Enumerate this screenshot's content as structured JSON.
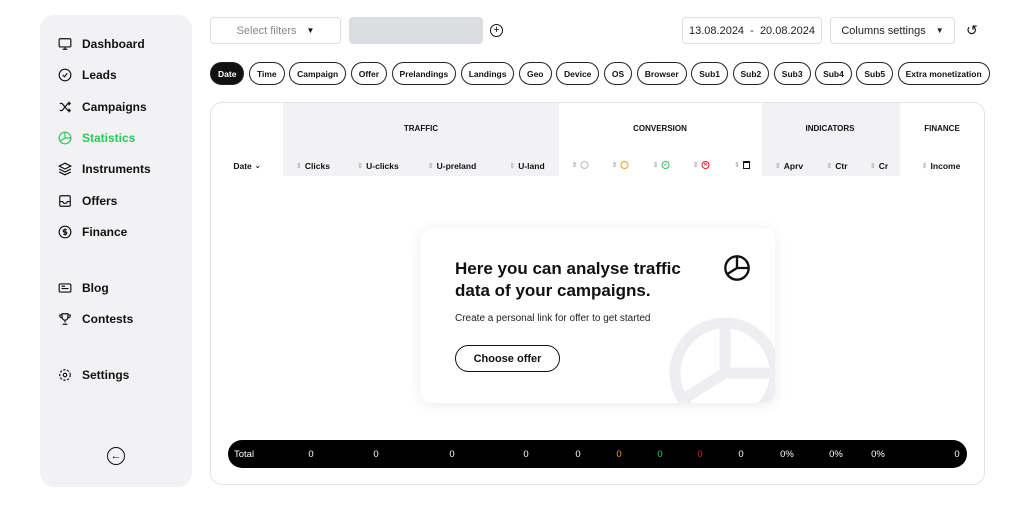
{
  "sidebar": {
    "items": [
      {
        "label": "Dashboard",
        "icon": "monitor-icon"
      },
      {
        "label": "Leads",
        "icon": "check-circle-icon"
      },
      {
        "label": "Campaigns",
        "icon": "shuffle-icon"
      },
      {
        "label": "Statistics",
        "icon": "pie-chart-icon",
        "active": true
      },
      {
        "label": "Instruments",
        "icon": "layers-icon"
      },
      {
        "label": "Offers",
        "icon": "inbox-icon"
      },
      {
        "label": "Finance",
        "icon": "dollar-icon"
      },
      {
        "label": "Blog",
        "icon": "newspaper-icon"
      },
      {
        "label": "Contests",
        "icon": "trophy-icon"
      },
      {
        "label": "Settings",
        "icon": "gear-icon"
      }
    ]
  },
  "toolbar": {
    "filters_placeholder": "Select filters",
    "date_range": "13.08.2024  -  20.08.2024",
    "columns_settings": "Columns settings"
  },
  "chips": [
    "Date",
    "Time",
    "Campaign",
    "Offer",
    "Prelandings",
    "Landings",
    "Geo",
    "Device",
    "OS",
    "Browser",
    "Sub1",
    "Sub2",
    "Sub3",
    "Sub4",
    "Sub5",
    "Extra monetization"
  ],
  "table": {
    "groups": {
      "traffic": "TRAFFIC",
      "conversion": "CONVERSION",
      "indicators": "INDICATORS",
      "finance": "FINANCE"
    },
    "columns": {
      "date": "Date",
      "clicks": "Clicks",
      "uclicks": "U-clicks",
      "upreland": "U-preland",
      "uland": "U-land",
      "aprv": "Aprv",
      "ctr": "Ctr",
      "cr": "Cr",
      "income": "Income"
    },
    "total_label": "Total",
    "totals": [
      "0",
      "0",
      "0",
      "0",
      "0",
      "0",
      "0",
      "0",
      "0",
      "0%",
      "0%",
      "0%",
      "0"
    ]
  },
  "colors": {
    "accent": "#2bc75a",
    "pending": "#f0a020",
    "approved": "#2bc75a",
    "rejected": "#e02020"
  },
  "empty": {
    "title": "Here you can analyse traffic data of your campaigns.",
    "subtitle": "Create a personal link for offer to get started",
    "button": "Choose offer"
  }
}
